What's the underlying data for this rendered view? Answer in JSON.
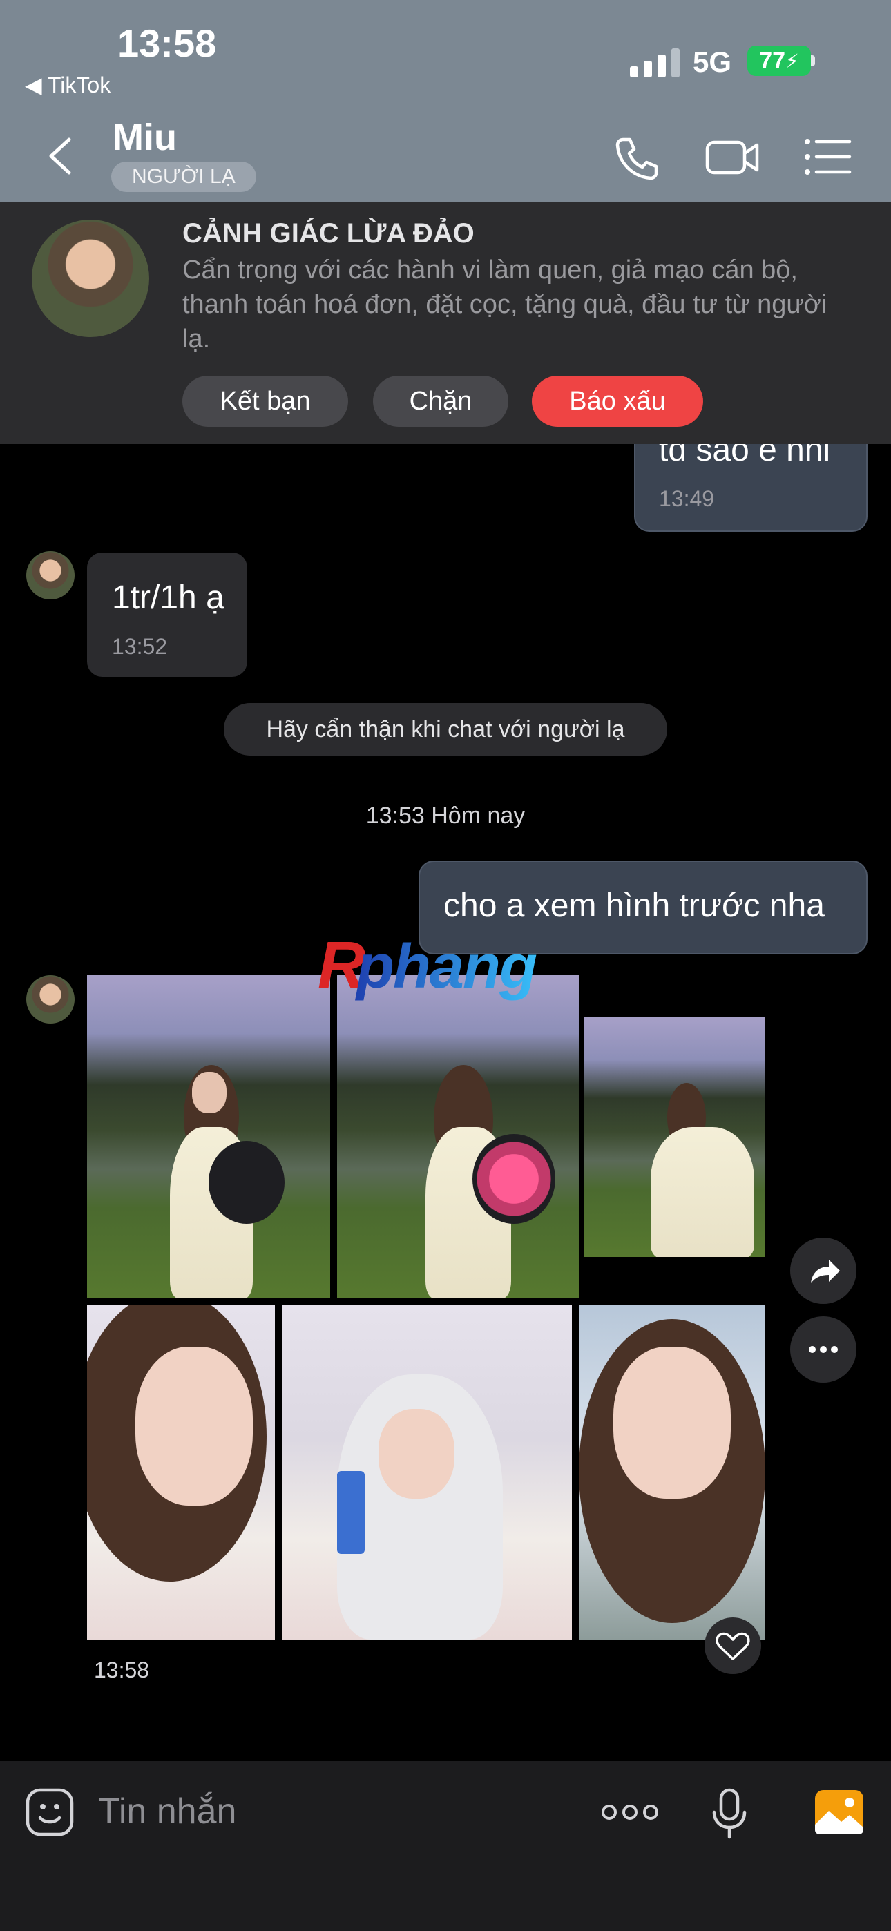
{
  "status_bar": {
    "time": "13:58",
    "back_app": "◀ TikTok",
    "network": "5G",
    "battery": "77"
  },
  "header": {
    "contact_name": "Miu",
    "badge": "NGƯỜI LẠ"
  },
  "warning": {
    "title": "CẢNH GIÁC LỪA ĐẢO",
    "text": "Cẩn trọng với các hành vi làm quen, giả mạo cán bộ, thanh toán hoá đơn, đặt cọc, tặng quà, đầu tư từ người lạ.",
    "buttons": {
      "add_friend": "Kết bạn",
      "block": "Chặn",
      "report": "Báo xấu"
    },
    "colors": {
      "report": "#ef4444"
    }
  },
  "messages": {
    "m1": {
      "text": "tđ sao e nhỉ",
      "time": "13:49"
    },
    "m2": {
      "text": "1tr/1h ạ",
      "time": "13:52"
    },
    "notice": "Hãy cẩn thận khi chat với người lạ",
    "date_separator": "13:53 Hôm nay",
    "m3": {
      "text": "cho a xem hình trước nha"
    },
    "photos_time": "13:58"
  },
  "watermark": "Rphang",
  "input": {
    "placeholder": "Tin nhắn"
  },
  "icons": {
    "back": "chevron-left-icon",
    "call": "phone-icon",
    "video": "video-camera-icon",
    "menu": "list-icon",
    "share": "share-arrow-icon",
    "more": "ellipsis-icon",
    "heart": "heart-icon",
    "emoji": "sticker-icon",
    "mic": "microphone-icon",
    "gallery": "image-icon"
  }
}
